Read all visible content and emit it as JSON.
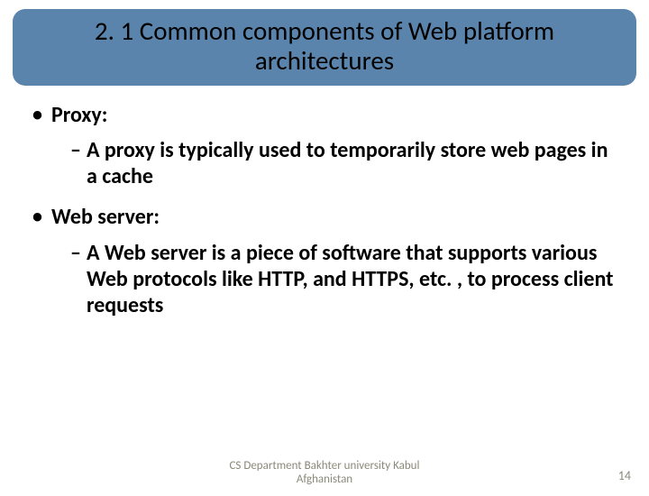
{
  "title": "2. 1 Common components of Web platform architectures",
  "items": [
    {
      "label": "Proxy:",
      "sub": "A proxy is typically used to temporarily store web pages in a cache"
    },
    {
      "label": "Web server:",
      "sub": "A Web server is a piece of software that supports various Web protocols like HTTP, and HTTPS, etc. , to process client requests"
    }
  ],
  "footer": {
    "line1": "CS Department Bakhter university Kabul",
    "line2": "Afghanistan"
  },
  "page_number": "14"
}
